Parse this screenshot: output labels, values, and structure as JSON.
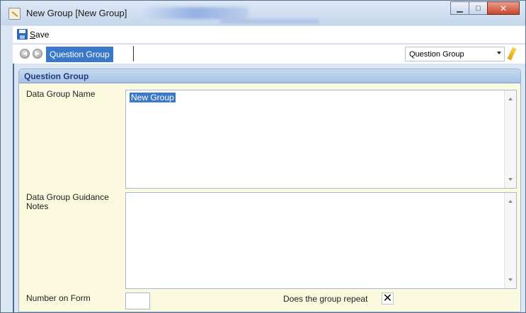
{
  "window": {
    "title": "New Group [New Group]",
    "minimize_glyph": "▁",
    "maximize_glyph": "□",
    "close_glyph": "✕"
  },
  "toolbar": {
    "save_label_underlined": "S",
    "save_label_rest": "ave"
  },
  "navbar": {
    "back_glyph": "◀",
    "forward_glyph": "▶",
    "breadcrumb": "Question Group",
    "combo_value": "Question Group"
  },
  "panel": {
    "header": "Question Group",
    "fields": {
      "name_label": "Data Group Name",
      "name_value": "New Group",
      "notes_label": "Data Group Guidance Notes",
      "notes_value": "",
      "number_label": "Number on Form",
      "number_value": "",
      "repeat_label": "Does the group repeat",
      "repeat_checked": true,
      "repeat_glyph": "✕"
    }
  },
  "colors": {
    "accent": "#3c78c8",
    "panel_bg": "#fbf9de",
    "header_text": "#1e3d80"
  },
  "icons": [
    "app-icon",
    "save-icon",
    "back-icon",
    "forward-icon",
    "pencil-icon",
    "scroll-up-icon",
    "scroll-down-icon"
  ]
}
